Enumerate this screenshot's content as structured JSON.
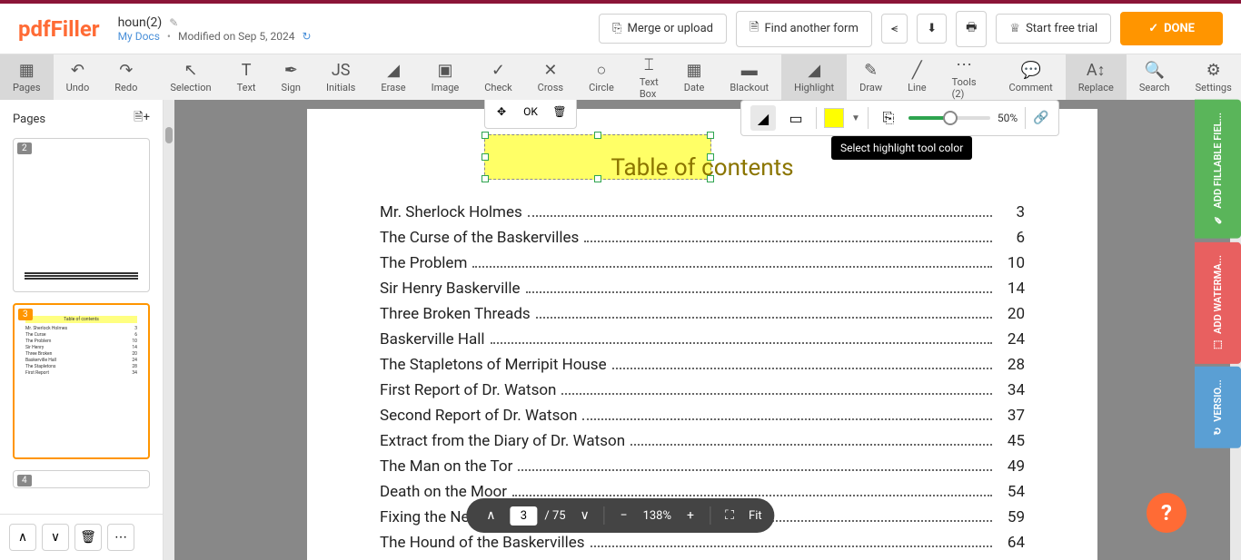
{
  "logo": "pdfFiller",
  "document": {
    "title": "houn(2)",
    "breadcrumb": "My Docs",
    "modified": "Modified on Sep 5, 2024"
  },
  "header_buttons": {
    "merge": "Merge or upload",
    "find": "Find another form",
    "trial": "Start free trial",
    "done": "DONE"
  },
  "toolbar": [
    {
      "id": "pages",
      "label": "Pages",
      "icon": "▦"
    },
    {
      "id": "undo",
      "label": "Undo",
      "icon": "↶"
    },
    {
      "id": "redo",
      "label": "Redo",
      "icon": "↷"
    },
    {
      "id": "selection",
      "label": "Selection",
      "icon": "↖"
    },
    {
      "id": "text",
      "label": "Text",
      "icon": "T"
    },
    {
      "id": "sign",
      "label": "Sign",
      "icon": "✒"
    },
    {
      "id": "initials",
      "label": "Initials",
      "icon": "JS"
    },
    {
      "id": "erase",
      "label": "Erase",
      "icon": "◢"
    },
    {
      "id": "image",
      "label": "Image",
      "icon": "▣"
    },
    {
      "id": "check",
      "label": "Check",
      "icon": "✓"
    },
    {
      "id": "cross",
      "label": "Cross",
      "icon": "✕"
    },
    {
      "id": "circle",
      "label": "Circle",
      "icon": "○"
    },
    {
      "id": "textbox",
      "label": "Text Box",
      "icon": "⌶"
    },
    {
      "id": "date",
      "label": "Date",
      "icon": "▦"
    },
    {
      "id": "blackout",
      "label": "Blackout",
      "icon": "▬"
    },
    {
      "id": "highlight",
      "label": "Highlight",
      "icon": "◢"
    },
    {
      "id": "draw",
      "label": "Draw",
      "icon": "✎"
    },
    {
      "id": "line",
      "label": "Line",
      "icon": "╱"
    },
    {
      "id": "tools",
      "label": "Tools (2)",
      "icon": "⋯"
    },
    {
      "id": "comment",
      "label": "Comment",
      "icon": "💬"
    },
    {
      "id": "replace",
      "label": "Replace",
      "icon": "A↕"
    },
    {
      "id": "search",
      "label": "Search",
      "icon": "🔍"
    },
    {
      "id": "settings",
      "label": "Settings",
      "icon": "⚙"
    }
  ],
  "highlight_options": {
    "opacity": "50%",
    "tooltip": "Select highlight tool color"
  },
  "selection_toolbar": {
    "ok": "OK"
  },
  "sidebar": {
    "title": "Pages",
    "thumbs": [
      {
        "num": "2"
      },
      {
        "num": "3"
      },
      {
        "num": "4"
      }
    ]
  },
  "toc": {
    "title": "Table of contents",
    "entries": [
      {
        "name": "Mr. Sherlock Holmes",
        "page": "3"
      },
      {
        "name": "The Curse of the Baskervilles",
        "page": "6"
      },
      {
        "name": "The Problem",
        "page": "10"
      },
      {
        "name": "Sir Henry Baskerville",
        "page": "14"
      },
      {
        "name": "Three Broken Threads",
        "page": "20"
      },
      {
        "name": "Baskerville Hall",
        "page": "24"
      },
      {
        "name": "The Stapletons of Merripit House",
        "page": "28"
      },
      {
        "name": "First Report of Dr. Watson",
        "page": "34"
      },
      {
        "name": "Second Report of Dr. Watson",
        "page": "37"
      },
      {
        "name": "Extract from the Diary of Dr. Watson",
        "page": "45"
      },
      {
        "name": "The Man on the Tor",
        "page": "49"
      },
      {
        "name": "Death on the Moor",
        "page": "54"
      },
      {
        "name": "Fixing the Nets",
        "page": "59"
      },
      {
        "name": "The Hound of the Baskervilles",
        "page": "64"
      }
    ]
  },
  "bottom_bar": {
    "current_page": "3",
    "total": "/ 75",
    "zoom": "138%",
    "fit": "Fit"
  },
  "side_tabs": {
    "fillable": "ADD FILLABLE FIEL...",
    "watermark": "ADD WATERMA...",
    "versions": "VERSIO..."
  }
}
